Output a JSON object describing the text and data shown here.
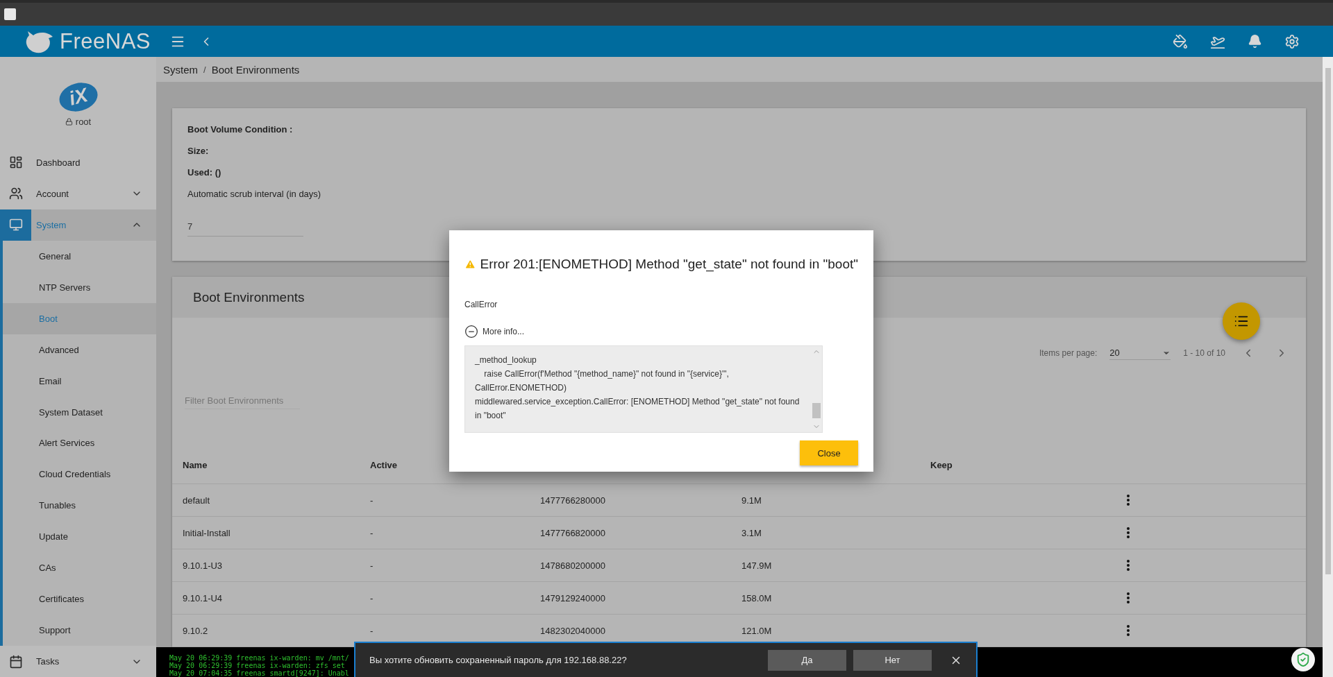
{
  "header": {
    "brand": "FreeNAS"
  },
  "sidebar": {
    "logo": "iX",
    "user": "root",
    "items": [
      {
        "label": "Dashboard",
        "selected": false
      },
      {
        "label": "Account",
        "selected": false,
        "expanded": false
      },
      {
        "label": "System",
        "selected": true,
        "expanded": true,
        "children": [
          {
            "label": "General",
            "selected": false
          },
          {
            "label": "NTP Servers",
            "selected": false
          },
          {
            "label": "Boot",
            "selected": true
          },
          {
            "label": "Advanced",
            "selected": false
          },
          {
            "label": "Email",
            "selected": false
          },
          {
            "label": "System Dataset",
            "selected": false
          },
          {
            "label": "Alert Services",
            "selected": false
          },
          {
            "label": "Cloud Credentials",
            "selected": false
          },
          {
            "label": "Tunables",
            "selected": false
          },
          {
            "label": "Update",
            "selected": false
          },
          {
            "label": "CAs",
            "selected": false
          },
          {
            "label": "Certificates",
            "selected": false
          },
          {
            "label": "Support",
            "selected": false
          }
        ]
      },
      {
        "label": "Tasks",
        "selected": false,
        "expanded": false
      }
    ]
  },
  "breadcrumb": {
    "items": [
      "System",
      "Boot Environments"
    ],
    "separator": "/"
  },
  "boot_volume": {
    "fields": [
      "Boot Volume Condition :",
      "Size:",
      "Used: ()"
    ],
    "scrub_label": "Automatic scrub interval (in days)",
    "scrub_value": "7"
  },
  "boot_environments": {
    "title": "Boot Environments",
    "filter_placeholder": "Filter Boot Environments",
    "items_per_page_label": "Items per page:",
    "items_per_page": "20",
    "range": "1 - 10 of 10",
    "columns": [
      "Name",
      "Active",
      "Keep"
    ],
    "rows": [
      {
        "name": "default",
        "active": "-",
        "column_3": "1477766280000",
        "column_4": "9.1M"
      },
      {
        "name": "Initial-Install",
        "active": "-",
        "column_3": "1477766820000",
        "column_4": "3.1M"
      },
      {
        "name": "9.10.1-U3",
        "active": "-",
        "column_3": "1478680200000",
        "column_4": "147.9M"
      },
      {
        "name": "9.10.1-U4",
        "active": "-",
        "column_3": "1479129240000",
        "column_4": "158.0M"
      },
      {
        "name": "9.10.2",
        "active": "-",
        "column_3": "1482302040000",
        "column_4": "121.0M"
      }
    ]
  },
  "dialog": {
    "title": "Error 201:[ENOMETHOD] Method \"get_state\" not found in \"boot\"",
    "subtitle": "CallError",
    "more_info": "More info...",
    "expanded": true,
    "traceback": [
      "_method_lookup",
      "    raise CallError(f'Method \"{method_name}\" not found in \"{service}\"', CallError.ENOMETHOD)",
      "middlewared.service_exception.CallError: [ENOMETHOD] Method \"get_state\" not found in \"boot\""
    ],
    "close": "Close"
  },
  "terminal": [
    "May 20 06:29:39 freenas ix-warden: mv /mnt/",
    "May 20 06:29:39 freenas ix-warden: zfs set",
    "May 20 07:04:35 freenas smartd[9247]: Unabl"
  ],
  "password_prompt": {
    "text": "Вы хотите обновить сохраненный пароль для 192.168.88.22?",
    "yes": "Да",
    "no": "Нет"
  }
}
